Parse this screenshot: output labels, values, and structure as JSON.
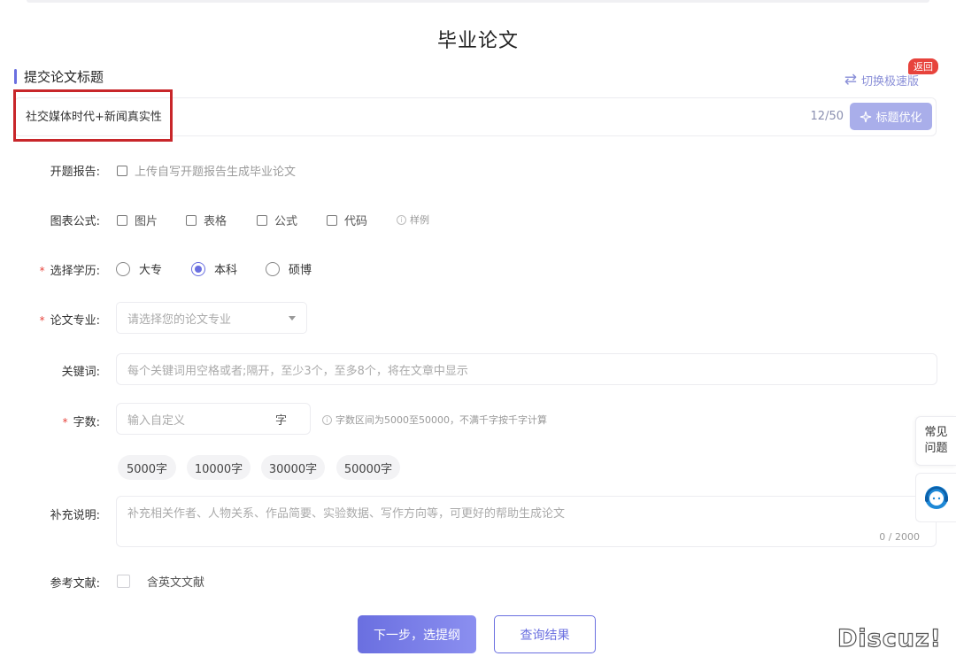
{
  "page_title": "毕业论文",
  "section_title": "提交论文标题",
  "switch_label": "切换极速版",
  "return_badge": "返回",
  "title_field": {
    "value": "社交媒体时代+新闻真实性",
    "counter": "12/50",
    "optimize_label": "标题优化"
  },
  "proposal": {
    "label": "开题报告:",
    "option": "上传自写开题报告生成毕业论文"
  },
  "charts": {
    "label": "图表公式:",
    "options": [
      "图片",
      "表格",
      "公式",
      "代码"
    ],
    "sample": "样例"
  },
  "degree": {
    "label": "选择学历:",
    "options": [
      "大专",
      "本科",
      "硕博"
    ],
    "selected": "本科"
  },
  "major": {
    "label": "论文专业:",
    "placeholder": "请选择您的论文专业"
  },
  "keywords": {
    "label": "关键词:",
    "placeholder": "每个关键词用空格或者;隔开，至少3个，至多8个，将在文章中显示"
  },
  "word_count": {
    "label": "字数:",
    "placeholder": "输入自定义",
    "unit": "字",
    "hint": "字数区间为5000至50000，不满千字按千字计算",
    "presets": [
      "5000字",
      "10000字",
      "30000字",
      "50000字"
    ]
  },
  "notes": {
    "label": "补充说明:",
    "placeholder": "补充相关作者、人物关系、作品简要、实验数据、写作方向等，可更好的帮助生成论文",
    "counter": "0 / 2000"
  },
  "references": {
    "label": "参考文献:",
    "option": "含英文文献"
  },
  "buttons": {
    "next": "下一步，选提纲",
    "query": "查询结果"
  },
  "side": {
    "faq_line1": "常见",
    "faq_line2": "问题"
  },
  "watermark": "Discuz!",
  "colors": {
    "accent": "#6a6fe0",
    "required": "#e7433c",
    "highlight_box": "#c8262a"
  }
}
